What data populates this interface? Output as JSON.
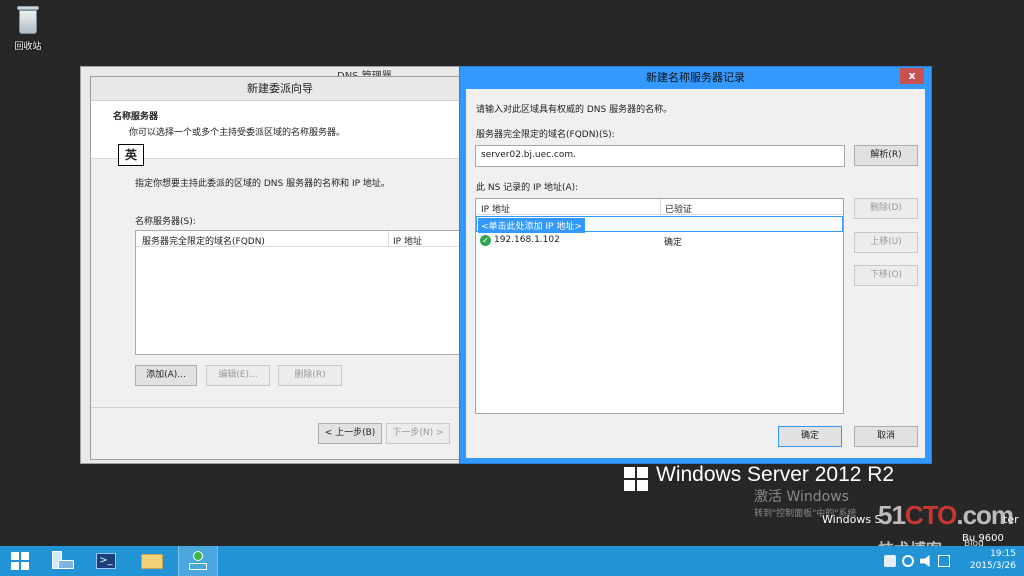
{
  "desktop": {
    "recycle_bin_label": "回收站",
    "os_brand": "Windows Server 2012 R2",
    "activation_title": "激活 Windows",
    "activation_hint": "转到\"控制面板\"中的\"系统",
    "edition_text": "Windows S",
    "edition_suffix": "ter",
    "build_text": "Bu   9600",
    "watermark_main_1": "51",
    "watermark_main_2": "CTO",
    "watermark_main_3": ".com",
    "watermark_sub": "技术博客",
    "watermark_blog": "Blog"
  },
  "dns_manager": {
    "title": "DNS 管理器"
  },
  "wizard": {
    "title": "新建委派向导",
    "header_title": "名称服务器",
    "header_desc": "你可以选择一个或多个主持受委派区域的名称服务器。",
    "instruction": "指定你想要主持此委派的区域的 DNS 服务器的名称和 IP 地址。",
    "list_label": "名称服务器(S):",
    "columns": [
      "服务器完全限定的域名(FQDN)",
      "IP 地址"
    ],
    "add_button": "添加(A)...",
    "edit_button": "编辑(E)...",
    "delete_button": "删除(R)",
    "back_button": "< 上一步(B)",
    "next_button": "下一步(N) >"
  },
  "ns_dialog": {
    "title": "新建名称服务器记录",
    "close_label": "x",
    "intro": "请输入对此区域具有权威的 DNS 服务器的名称。",
    "fqdn_label": "服务器完全限定的域名(FQDN)(S):",
    "fqdn_value": "server02.bj.uec.com.",
    "resolve_button": "解析(R)",
    "ip_label": "此 NS 记录的 IP 地址(A):",
    "columns": [
      "IP 地址",
      "已验证"
    ],
    "add_row_text": "<单击此处添加 IP 地址>",
    "rows": [
      {
        "ip": "192.168.1.102",
        "verified": "确定"
      }
    ],
    "delete_button": "删除(D)",
    "up_button": "上移(U)",
    "down_button": "下移(O)",
    "ok_button": "确定",
    "cancel_button": "取消",
    "ime_indicator": "英"
  },
  "taskbar": {
    "time": "19:15",
    "date": "2015/3/26"
  }
}
